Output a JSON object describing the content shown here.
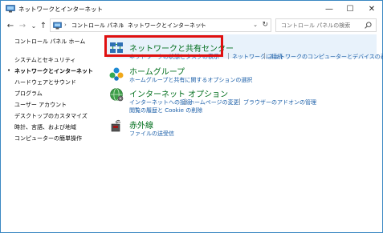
{
  "window": {
    "title": "ネットワークとインターネット",
    "minimize": "—",
    "maximize": "☐",
    "close": "✕"
  },
  "nav": {
    "back": "←",
    "forward": "→",
    "up": "↑",
    "breadcrumbs": [
      "コントロール パネル",
      "ネットワークとインターネット"
    ],
    "separator": "›",
    "search_placeholder": "コントロール パネルの検索"
  },
  "sidebar": {
    "items": [
      {
        "label": "コントロール パネル ホーム",
        "current": false
      },
      {
        "label": "システムとセキュリティ",
        "current": false
      },
      {
        "label": "ネットワークとインターネット",
        "current": true
      },
      {
        "label": "ハードウェアとサウンド",
        "current": false
      },
      {
        "label": "プログラム",
        "current": false
      },
      {
        "label": "ユーザー アカウント",
        "current": false
      },
      {
        "label": "デスクトップのカスタマイズ",
        "current": false
      },
      {
        "label": "時計、言語、および地域",
        "current": false
      },
      {
        "label": "コンピューターの簡単操作",
        "current": false
      }
    ]
  },
  "categories": [
    {
      "title": "ネットワークと共有センター",
      "icon": "network-sharing-icon",
      "links": [
        "ネットワークの状態とタスクの表示",
        "ネットワークに接続",
        "ネットワークのコンピューターとデバイスの表示"
      ]
    },
    {
      "title": "ホームグループ",
      "icon": "homegroup-icon",
      "links": [
        "ホームグループと共有に関するオプションの選択"
      ]
    },
    {
      "title": "インターネット オプション",
      "icon": "internet-options-icon",
      "links": [
        "インターネットへの接続",
        "ホームページの変更",
        "ブラウザーのアドオンの管理",
        "閲覧の履歴と Cookie の削除"
      ]
    },
    {
      "title": "赤外線",
      "icon": "infrared-icon",
      "links": [
        "ファイルの送受信"
      ]
    }
  ],
  "colors": {
    "category_title": "#006e1c",
    "link": "#1a5ea8",
    "highlight": "#e8f2fb",
    "annotation": "#e01010",
    "window_border": "#3b88c3"
  }
}
